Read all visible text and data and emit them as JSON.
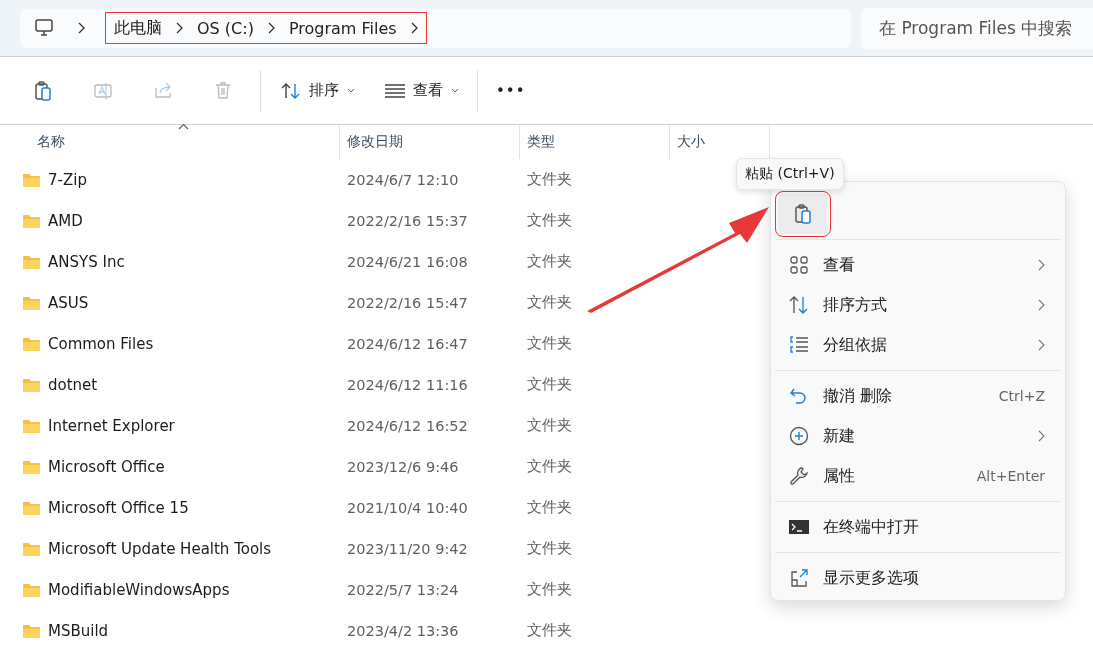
{
  "address_bar": {
    "crumbs": [
      "此电脑",
      "OS (C:)",
      "Program Files"
    ],
    "highlighted": true
  },
  "search": {
    "placeholder": "在 Program Files 中搜索"
  },
  "toolbar": {
    "actions": [
      {
        "kind": "paste",
        "disabled": false
      },
      {
        "kind": "rename",
        "disabled": true
      },
      {
        "kind": "share",
        "disabled": true
      },
      {
        "kind": "delete",
        "disabled": true
      }
    ],
    "sort": {
      "label": "排序"
    },
    "view": {
      "label": "查看"
    },
    "more": "•••"
  },
  "table": {
    "columns": [
      {
        "label": "名称",
        "sorted": true
      },
      {
        "label": "修改日期",
        "sorted": false
      },
      {
        "label": "类型",
        "sorted": false
      },
      {
        "label": "大小",
        "sorted": false
      }
    ],
    "rows": [
      {
        "name": "7-Zip",
        "date": "2024/6/7 12:10",
        "type": "文件夹"
      },
      {
        "name": "AMD",
        "date": "2022/2/16 15:37",
        "type": "文件夹"
      },
      {
        "name": "ANSYS Inc",
        "date": "2024/6/21 16:08",
        "type": "文件夹"
      },
      {
        "name": "ASUS",
        "date": "2022/2/16 15:47",
        "type": "文件夹"
      },
      {
        "name": "Common Files",
        "date": "2024/6/12 16:47",
        "type": "文件夹"
      },
      {
        "name": "dotnet",
        "date": "2024/6/12 11:16",
        "type": "文件夹"
      },
      {
        "name": "Internet Explorer",
        "date": "2024/6/12 16:52",
        "type": "文件夹"
      },
      {
        "name": "Microsoft Office",
        "date": "2023/12/6 9:46",
        "type": "文件夹"
      },
      {
        "name": "Microsoft Office 15",
        "date": "2021/10/4 10:40",
        "type": "文件夹"
      },
      {
        "name": "Microsoft Update Health Tools",
        "date": "2023/11/20 9:42",
        "type": "文件夹"
      },
      {
        "name": "ModifiableWindowsApps",
        "date": "2022/5/7 13:24",
        "type": "文件夹"
      },
      {
        "name": "MSBuild",
        "date": "2023/4/2 13:36",
        "type": "文件夹"
      }
    ]
  },
  "context_menu": {
    "tooltip": "粘贴 (Ctrl+V)",
    "paste_highlighted": true,
    "groups": [
      [
        {
          "kind": "view",
          "label": "查看",
          "submenu": true
        },
        {
          "kind": "sort",
          "label": "排序方式",
          "submenu": true
        },
        {
          "kind": "group",
          "label": "分组依据",
          "submenu": true
        }
      ],
      [
        {
          "kind": "undo",
          "label": "撤消 删除",
          "shortcut": "Ctrl+Z",
          "submenu": false
        },
        {
          "kind": "new",
          "label": "新建",
          "submenu": true
        },
        {
          "kind": "properties",
          "label": "属性",
          "shortcut": "Alt+Enter",
          "submenu": false
        }
      ],
      [
        {
          "kind": "terminal",
          "label": "在终端中打开",
          "submenu": false
        }
      ],
      [
        {
          "kind": "more",
          "label": "显示更多选项",
          "submenu": false
        }
      ]
    ]
  },
  "annotation": {
    "kind": "arrow"
  }
}
